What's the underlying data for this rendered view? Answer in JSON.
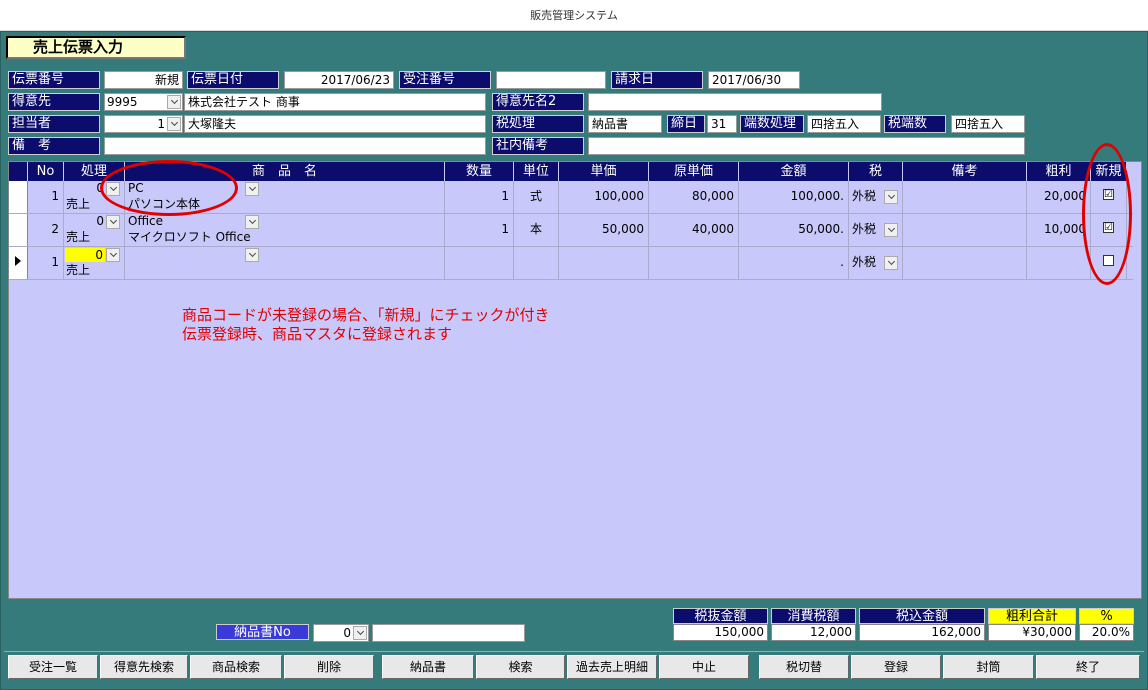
{
  "window": {
    "title": "販売管理システム"
  },
  "form": {
    "title": "売上伝票入力"
  },
  "header": {
    "slip_no_label": "伝票番号",
    "slip_no": "新規",
    "slip_date_label": "伝票日付",
    "slip_date": "2017/06/23",
    "order_no_label": "受注番号",
    "order_no": "",
    "billing_date_label": "請求日",
    "billing_date": "2017/06/30",
    "customer_label": "得意先",
    "customer_code": "9995",
    "customer_name": "株式会社テスト 商事",
    "customer_name2_label": "得意先名2",
    "customer_name2": "",
    "staff_label": "担当者",
    "staff_code": "1",
    "staff_name": "大塚隆夫",
    "tax_process_label": "税処理",
    "tax_process": "納品書",
    "closing_label": "締日",
    "closing_day": "31",
    "rounding_label": "端数処理",
    "rounding": "四捨五入",
    "tax_rounding_label": "税端数",
    "tax_rounding": "四捨五入",
    "remarks_label": "備　考",
    "remarks": "",
    "internal_remarks_label": "社内備考",
    "internal_remarks": ""
  },
  "grid": {
    "columns": [
      "No",
      "処理",
      "商　品　名",
      "数量",
      "単位",
      "単価",
      "原単価",
      "金額",
      "税",
      "備考",
      "粗利",
      "新規"
    ],
    "rows": [
      {
        "no": "1",
        "proc_code": "0",
        "proc": "売上",
        "product_code": "PC",
        "product_name": "パソコン本体",
        "qty": "1",
        "unit": "式",
        "price": "100,000",
        "cost": "80,000",
        "amount": "100,000.",
        "tax": "外税",
        "remarks": "",
        "profit": "20,000",
        "new": "☑"
      },
      {
        "no": "2",
        "proc_code": "0",
        "proc": "売上",
        "product_code": "Office",
        "product_name": "マイクロソフト Office",
        "qty": "1",
        "unit": "本",
        "price": "50,000",
        "cost": "40,000",
        "amount": "50,000.",
        "tax": "外税",
        "remarks": "",
        "profit": "10,000",
        "new": "☑"
      },
      {
        "no": "1",
        "proc_code": "0",
        "proc": "売上",
        "product_code": "",
        "product_name": "",
        "qty": "",
        "unit": "",
        "price": "",
        "cost": "",
        "amount": ".",
        "tax": "外税",
        "remarks": "",
        "profit": "",
        "new": ""
      }
    ]
  },
  "annotation": {
    "line1": "商品コードが未登録の場合、「新規」にチェックが付き",
    "line2": "伝票登録時、商品マスタに登録されます"
  },
  "footer": {
    "delivery_no_label": "納品書No",
    "delivery_no": "0",
    "delivery_extra": "",
    "subtotal_label": "税抜金額",
    "subtotal": "150,000",
    "tax_label": "消費税額",
    "tax": "12,000",
    "total_label": "税込金額",
    "total": "162,000",
    "profit_label": "粗利合計",
    "profit": "¥30,000",
    "pct_label": "%",
    "pct": "20.0%"
  },
  "buttons": [
    "受注一覧",
    "得意先検索",
    "商品検索",
    "削除",
    "納品書",
    "検索",
    "過去売上明細",
    "中止",
    "税切替",
    "登録",
    "封筒",
    "終了"
  ],
  "colors": {
    "teal": "#357b7b",
    "navy": "#0c0c6c",
    "grid": "#c8c8fa",
    "highlight": "#ffff00",
    "annotation": "#e00000"
  }
}
